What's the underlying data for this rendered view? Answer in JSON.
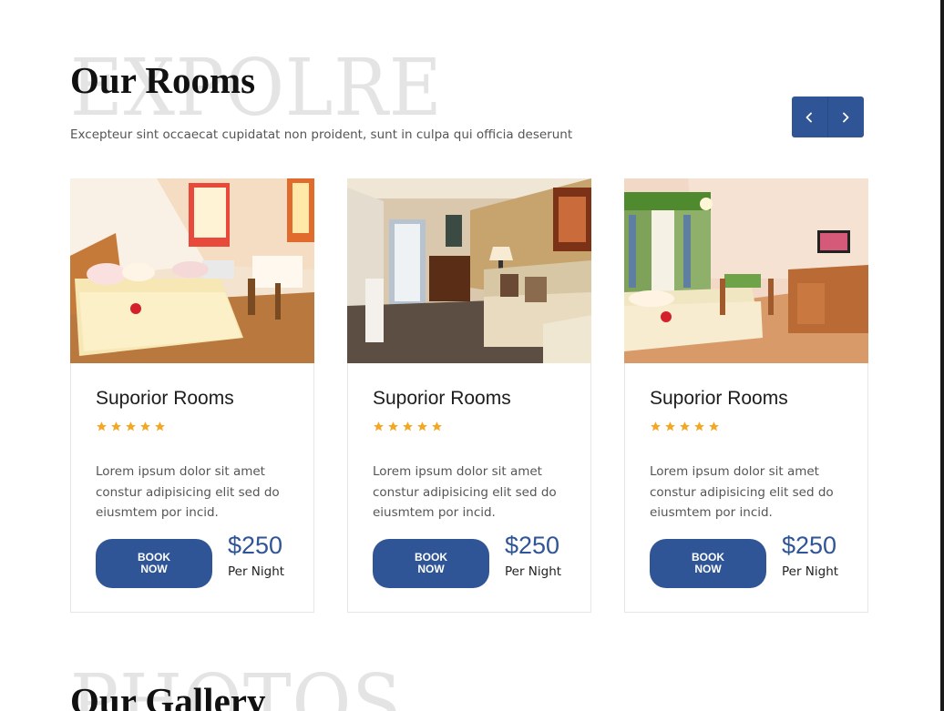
{
  "rooms_section": {
    "background_word": "EXPOLRE",
    "title": "Our Rooms",
    "subtitle": "Excepteur sint occaecat cupidatat non proident, sunt in culpa qui officia deserunt",
    "nav": {
      "prev_icon": "chevron-left-icon",
      "next_icon": "chevron-right-icon"
    }
  },
  "cards": [
    {
      "name": "Suporior Rooms",
      "rating": 5,
      "description": "Lorem ipsum dolor sit amet constur adipisicing elit sed do eiusmtem por incid.",
      "book_label": "BOOK NOW",
      "price": "$250",
      "price_unit": "Per Night"
    },
    {
      "name": "Suporior Rooms",
      "rating": 5,
      "description": "Lorem ipsum dolor sit amet constur adipisicing elit sed do eiusmtem por incid.",
      "book_label": "BOOK NOW",
      "price": "$250",
      "price_unit": "Per Night"
    },
    {
      "name": "Suporior Rooms",
      "rating": 5,
      "description": "Lorem ipsum dolor sit amet constur adipisicing elit sed do eiusmtem por incid.",
      "book_label": "BOOK NOW",
      "price": "$250",
      "price_unit": "Per Night"
    }
  ],
  "gallery_section": {
    "background_word": "PHOTOS",
    "title": "Our Gallery"
  },
  "colors": {
    "accent": "#2f5596",
    "star": "#f5a623",
    "background_word": "#e4e4e4"
  }
}
